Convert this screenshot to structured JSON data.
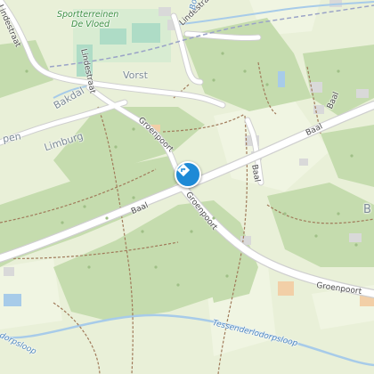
{
  "map": {
    "marker_icon": "directions-icon",
    "colors": {
      "background": "#e9f0d8",
      "forest": "#c5dcae",
      "road": "#ffffff",
      "road_casing": "#cfcfcf",
      "path": "#a07a5a",
      "water": "#a7cbe9",
      "sport": "#aedcc6",
      "building": "#d9d9d9",
      "marker": "#1e8ad6"
    },
    "labels": {
      "lindestraat_west": "Lindestraat",
      "lindestraat_mid": "Lindestraat",
      "lindestraat_east": "Lindestraat",
      "sportterreinen_line1": "Sportterreinen",
      "sportterreinen_line2": "De Vloed",
      "vorst": "Vorst",
      "bakdal": "Bakdal",
      "limburg": "Limburg",
      "pen": "pen",
      "groenpoort_north": "Groenpoort",
      "groenpoort_mid": "Groenpoort",
      "groenpoort_east": "Groenpoort",
      "baal_west": "Baal",
      "baal_mid": "Baal",
      "baal_east": "Baal",
      "baal_side": "Baal",
      "b_east": "B",
      "sloop_west": "dorpsloop",
      "sloop_east": "Tessenderlodorpsloop",
      "bo_top": "Bo"
    }
  }
}
